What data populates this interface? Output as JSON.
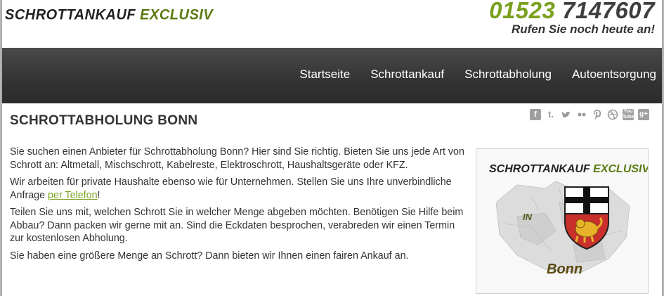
{
  "header": {
    "logo_main": "Schrottankauf ",
    "logo_accent": "Exclusiv",
    "phone_prefix": "01523",
    "phone_number": " 7147607",
    "tagline": "Rufen Sie noch heute an!"
  },
  "nav": {
    "items": [
      "Startseite",
      "Schrottankauf",
      "Schrottabholung",
      "Autoentsorgung"
    ]
  },
  "social": {
    "icons": [
      "facebook-icon",
      "tumblr-icon",
      "twitter-icon",
      "flickr-icon",
      "pinterest-icon",
      "dribbble-icon",
      "youtube-icon",
      "googleplus-icon"
    ]
  },
  "main": {
    "title": "SCHROTTABHOLUNG BONN",
    "p1": "Sie suchen einen Anbieter für Schrottabholung Bonn? Hier sind Sie richtig. Bieten Sie uns jede Art von Schrott an: Altmetall, Mischschrott, Kabelreste, Elektroschrott, Haushaltsgeräte oder KFZ.",
    "p2_before": "Wir arbeiten für private Haushalte ebenso wie für Unternehmen. Stellen Sie uns Ihre unverbindliche Anfrage ",
    "p2_link": "per Telefon",
    "p2_after": "!",
    "p3": "Teilen Sie uns mit, welchen Schrott Sie in welcher Menge abgeben möchten. Benötigen Sie Hilfe beim Abbau? Dann packen wir gerne mit an. Sind die Eckdaten besprochen, verabreden wir einen Termin zur kostenlosen Abholung.",
    "p4": "Sie haben eine größere Menge an Schrott? Dann bieten wir Ihnen einen fairen Ankauf an."
  },
  "badge": {
    "title_main": "Schrottankauf ",
    "title_accent": "Exclusiv",
    "in": "IN",
    "city": "Bonn"
  },
  "colors": {
    "accent": "#7aa01e",
    "nav_bg": "#333333",
    "text": "#333333"
  }
}
